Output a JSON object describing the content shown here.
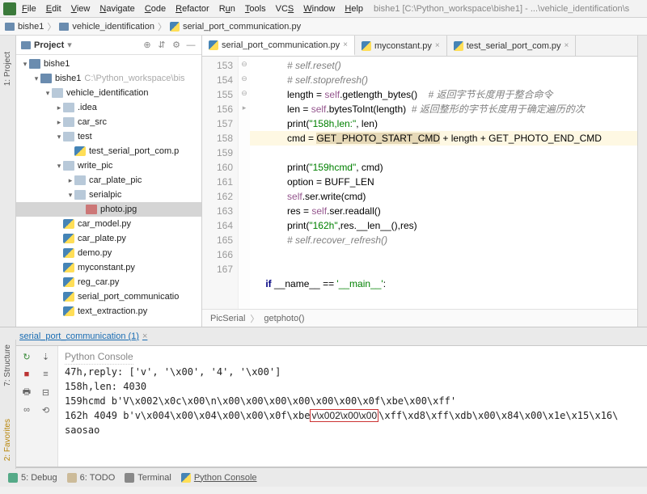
{
  "window": {
    "title": "bishe1 [C:\\Python_workspace\\bishe1] - ...\\vehicle_identification\\s"
  },
  "menu": {
    "file": "File",
    "edit": "Edit",
    "view": "View",
    "navigate": "Navigate",
    "code": "Code",
    "refactor": "Refactor",
    "run": "Run",
    "tools": "Tools",
    "vcs": "VCS",
    "window": "Window",
    "help": "Help"
  },
  "nav": {
    "seg0": "bishe1",
    "seg1": "vehicle_identification",
    "seg2": "serial_port_communication.py"
  },
  "project": {
    "title": "Project",
    "tree": [
      {
        "indent": 0,
        "caret": "▾",
        "icon": "i-proj",
        "label": "bishe1",
        "sel": false
      },
      {
        "indent": 1,
        "caret": "▾",
        "icon": "i-proj",
        "label": "bishe1",
        "hint": "C:\\Python_workspace\\bis",
        "sel": false
      },
      {
        "indent": 2,
        "caret": "▾",
        "icon": "i-folder",
        "label": "vehicle_identification",
        "sel": false
      },
      {
        "indent": 3,
        "caret": "▸",
        "icon": "i-folder",
        "label": ".idea",
        "sel": false
      },
      {
        "indent": 3,
        "caret": "▸",
        "icon": "i-folder",
        "label": "car_src",
        "sel": false
      },
      {
        "indent": 3,
        "caret": "▾",
        "icon": "i-folder",
        "label": "test",
        "sel": false
      },
      {
        "indent": 4,
        "caret": "",
        "icon": "i-py",
        "label": "test_serial_port_com.p",
        "sel": false
      },
      {
        "indent": 3,
        "caret": "▾",
        "icon": "i-folder",
        "label": "write_pic",
        "sel": false
      },
      {
        "indent": 4,
        "caret": "▸",
        "icon": "i-folder",
        "label": "car_plate_pic",
        "sel": false
      },
      {
        "indent": 4,
        "caret": "▾",
        "icon": "i-folder",
        "label": "serialpic",
        "sel": false
      },
      {
        "indent": 5,
        "caret": "",
        "icon": "i-img",
        "label": "photo.jpg",
        "sel": true
      },
      {
        "indent": 3,
        "caret": "",
        "icon": "i-py",
        "label": "car_model.py",
        "sel": false
      },
      {
        "indent": 3,
        "caret": "",
        "icon": "i-py",
        "label": "car_plate.py",
        "sel": false
      },
      {
        "indent": 3,
        "caret": "",
        "icon": "i-py",
        "label": "demo.py",
        "sel": false
      },
      {
        "indent": 3,
        "caret": "",
        "icon": "i-py",
        "label": "myconstant.py",
        "sel": false
      },
      {
        "indent": 3,
        "caret": "",
        "icon": "i-py",
        "label": "reg_car.py",
        "sel": false
      },
      {
        "indent": 3,
        "caret": "",
        "icon": "i-py",
        "label": "serial_port_communicatio",
        "sel": false
      },
      {
        "indent": 3,
        "caret": "",
        "icon": "i-py",
        "label": "text_extraction.py",
        "sel": false
      }
    ]
  },
  "sideTabs": {
    "project": "1: Project",
    "structure": "7: Structure",
    "favorites": "2: Favorites"
  },
  "editor": {
    "tabs": [
      {
        "label": "serial_port_communication.py",
        "active": true
      },
      {
        "label": "myconstant.py",
        "active": false
      },
      {
        "label": "test_serial_port_com.py",
        "active": false
      }
    ],
    "firstLine": 153,
    "breadcrumb": {
      "class": "PicSerial",
      "method": "getphoto()"
    },
    "lines": [
      {
        "kind": "cmt",
        "text": "# self.reset()"
      },
      {
        "kind": "cmt",
        "text": "# self.stoprefresh()"
      },
      {
        "kind": "code",
        "html": "length = <span class='c-self'>self</span>.getlength_bytes()    <span class='c-cmt'># 返回字节长度用于整合命令</span>"
      },
      {
        "kind": "code",
        "html": "len = <span class='c-self'>self</span>.bytesToInt(length)  <span class='c-cmt'># 返回整形的字节长度用于确定遍历的次</span>"
      },
      {
        "kind": "code",
        "html": "print(<span class='c-str'>\"158h,len:\"</span>, len)"
      },
      {
        "kind": "hl",
        "html": "cmd = <span class='c-hlid'>GET_PHOTO_START_CMD</span> + length + GET_PHOTO_END_CMD"
      },
      {
        "kind": "code",
        "html": "print(<span class='c-str'>\"159hcmd\"</span>, cmd)"
      },
      {
        "kind": "code",
        "html": "option = BUFF_LEN"
      },
      {
        "kind": "code",
        "html": "<span class='c-self'>self</span>.ser.write(cmd)"
      },
      {
        "kind": "code",
        "html": "res = <span class='c-self'>self</span>.ser.readall()"
      },
      {
        "kind": "code",
        "html": "print(<span class='c-str'>\"162h\"</span>,res.__len__(),res)"
      },
      {
        "kind": "cmt",
        "text": "# self.recover_refresh()"
      },
      {
        "kind": "blank",
        "text": ""
      },
      {
        "kind": "blank",
        "text": ""
      },
      {
        "kind": "main",
        "html": "<span class='c-kw'>if</span> __name__ == <span class='c-str'>'__main__'</span>:"
      }
    ]
  },
  "consoleTab": {
    "label": "serial_port_communication (1)"
  },
  "console": {
    "title": "Python Console",
    "lines": [
      "47h,reply: ['v', '\\x00', '4', '\\x00']",
      "158h,len: 4030",
      "159hcmd b'V\\x002\\x0c\\x00\\n\\x00\\x00\\x00\\x00\\x00\\x00\\x0f\\xbe\\x00\\xff'",
      {
        "pre": "162h 4049 b'v\\x004\\x00\\x04\\x00\\x00\\x0f\\xbe",
        "box": "v\\x002\\x00\\x00",
        "post": "\\xff\\xd8\\xff\\xdb\\x00\\x84\\x00\\x1e\\x15\\x16\\"
      },
      "saosao"
    ]
  },
  "status": {
    "debug": "5: Debug",
    "todo": "6: TODO",
    "terminal": "Terminal",
    "pyconsole": "Python Console"
  }
}
